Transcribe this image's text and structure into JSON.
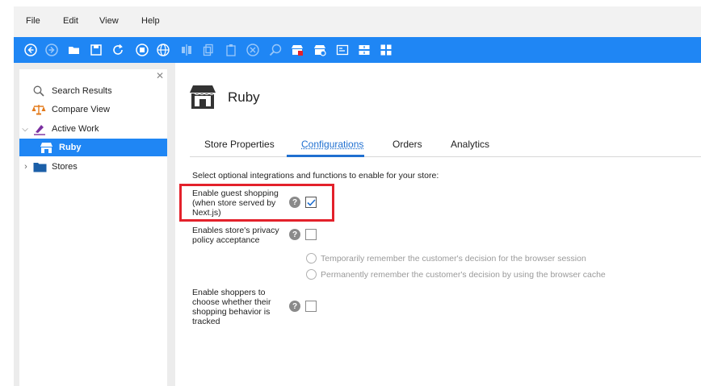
{
  "menu": {
    "file": "File",
    "edit": "Edit",
    "view": "View",
    "help": "Help"
  },
  "colors": {
    "toolbar": "#1f86f4",
    "selection": "#1f86f4",
    "active_tab": "#1f6fd0",
    "highlight": "#e3212b"
  },
  "toolbar": {
    "icons": [
      "back-icon",
      "forward-icon",
      "open-folder-icon",
      "save-icon",
      "refresh-icon",
      "stop-icon",
      "globe-icon",
      "align-icon",
      "copy-icon",
      "paste-icon",
      "delete-icon",
      "find-icon",
      "store-new-icon",
      "store-view-icon",
      "image-icon",
      "split-horizontal-icon",
      "grid-icon"
    ]
  },
  "tree": {
    "items": [
      {
        "label": "Search Results",
        "icon": "search-icon"
      },
      {
        "label": "Compare View",
        "icon": "compare-icon"
      },
      {
        "label": "Active Work",
        "icon": "active-work-icon"
      },
      {
        "label": "Ruby",
        "icon": "store-icon"
      },
      {
        "label": "Stores",
        "icon": "folder-icon"
      }
    ]
  },
  "page": {
    "title": "Ruby",
    "tabs": [
      "Store Properties",
      "Configurations",
      "Orders",
      "Analytics"
    ],
    "active_tab": "Configurations",
    "intro": "Select optional integrations and functions to enable for your store:",
    "options": [
      {
        "label_lines": [
          "Enable guest shopping",
          "(when store served by",
          "Next.js)"
        ],
        "checked": true
      },
      {
        "label_lines": [
          "Enables store's privacy",
          "policy acceptance"
        ],
        "checked": false
      },
      {
        "label_lines": [
          "Enable shoppers to",
          "choose whether their",
          "shopping behavior is",
          "tracked"
        ],
        "checked": false
      }
    ],
    "radios": [
      "Temporarily remember the customer's decision for the browser session",
      "Permanently remember the customer's decision by using the browser cache"
    ],
    "help_glyph": "?"
  }
}
